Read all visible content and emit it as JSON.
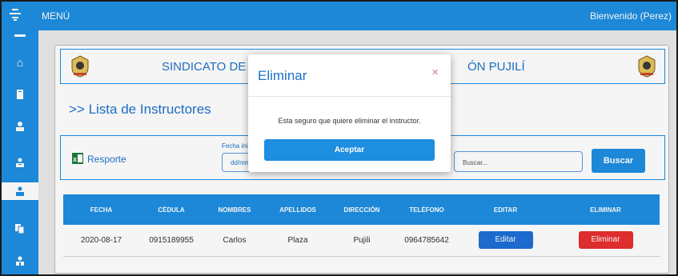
{
  "topbar": {
    "menu_label": "MENÚ",
    "welcome": "Bienvenido (Perez)"
  },
  "sidebar": {
    "items": [
      {
        "icon": "home-icon"
      },
      {
        "icon": "book-icon"
      },
      {
        "icon": "user-icon"
      },
      {
        "icon": "id-card-icon"
      },
      {
        "icon": "users-icon",
        "active": true
      },
      {
        "icon": "copy-icon"
      },
      {
        "icon": "user-group-icon"
      }
    ]
  },
  "header": {
    "title_left": "SINDICATO DE C",
    "title_right": "ÓN PUJILÍ"
  },
  "list_title": ">> Lista de Instructores",
  "filters": {
    "report_label": "Resporte",
    "date_label": "Fecha inic",
    "date_placeholder": "dd/mm",
    "search_placeholder": "Buscar...",
    "search_button": "Buscar"
  },
  "table": {
    "headers": [
      "FECHA",
      "CÉDULA",
      "NOMBRES",
      "APELLIDOS",
      "DIRECCIÓN",
      "TELÉFONO",
      "EDITAR",
      "ELIMINAR"
    ],
    "rows": [
      {
        "fecha": "2020-08-17",
        "cedula": "0915189955",
        "nombres": "Carlos",
        "apellidos": "Plaza",
        "direccion": "Pujili",
        "telefono": "0964785642",
        "edit_label": "Editar",
        "delete_label": "Eliminar"
      }
    ]
  },
  "modal": {
    "title": "Eliminar",
    "close": "×",
    "message": "Esta seguro que quiere eliminar el instructor.",
    "accept": "Aceptar"
  },
  "colors": {
    "primary": "#1e8ee0",
    "title_blue": "#1e72c8",
    "danger": "#e62f2f",
    "edit": "#1e6fd6"
  }
}
